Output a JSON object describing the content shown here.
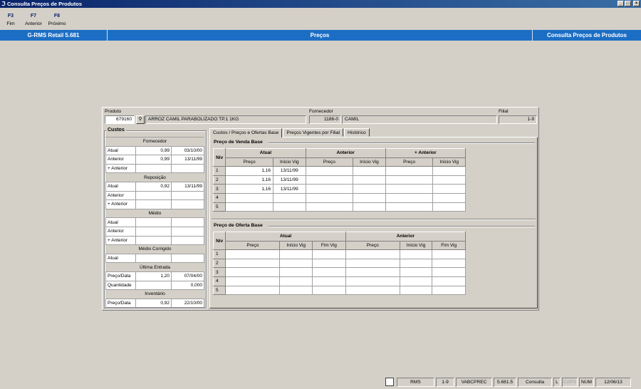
{
  "window": {
    "title": "Consulta Preços de Produtos",
    "min": "_",
    "max": "□",
    "close": "×"
  },
  "fkeys": [
    {
      "key": "F3",
      "label": "Fim"
    },
    {
      "key": "F7",
      "label": "Anterior"
    },
    {
      "key": "F8",
      "label": "Próximo"
    }
  ],
  "band": {
    "left": "G-RMS Retail 5.681",
    "center": "Preços",
    "right": "Consulta Preços de Produtos"
  },
  "produto": {
    "label": "Produto",
    "code": "679160",
    "desc": "ARROZ CAMIL PARABOLIZADO TP.1 1KG"
  },
  "fornecedor": {
    "label": "Fornecedor",
    "code": "1186-0",
    "name": "CAMIL"
  },
  "filial": {
    "label": "Filial",
    "value": "1-9"
  },
  "custos": {
    "title": "Custos",
    "fornecedor": {
      "title": "Fornecedor",
      "rows": [
        {
          "label": "Atual",
          "v1": "0,99",
          "v2": "03/10/00"
        },
        {
          "label": "Anterior",
          "v1": "0,99",
          "v2": "13/11/99"
        },
        {
          "label": "+ Anterior",
          "v1": "",
          "v2": ""
        }
      ]
    },
    "reposicao": {
      "title": "Reposição",
      "rows": [
        {
          "label": "Atual",
          "v1": "0,92",
          "v2": "13/11/99"
        },
        {
          "label": "Anterior",
          "v1": "",
          "v2": ""
        },
        {
          "label": "+ Anterior",
          "v1": "",
          "v2": ""
        }
      ]
    },
    "medio": {
      "title": "Médio",
      "rows": [
        {
          "label": "Atual",
          "v1": "",
          "v2": ""
        },
        {
          "label": "Anterior",
          "v1": "",
          "v2": ""
        },
        {
          "label": "+ Anterior",
          "v1": "",
          "v2": ""
        }
      ]
    },
    "medio_corrigido": {
      "title": "Médio Corrigido",
      "rows": [
        {
          "label": "Atual",
          "v1": "",
          "v2": ""
        }
      ]
    },
    "ultima_entrada": {
      "title": "Última Entrada",
      "rows": [
        {
          "label": "Preço/Data",
          "v1": "1,20",
          "v2": "07/04/00"
        },
        {
          "label": "Quantidade",
          "v1": "",
          "v2": "0,000"
        }
      ]
    },
    "inventario": {
      "title": "Inventário",
      "rows": [
        {
          "label": "Preço/Data",
          "v1": "0,92",
          "v2": "22/10/00"
        }
      ]
    }
  },
  "tabs": [
    {
      "label": "Custos / Preços e Ofertas Base"
    },
    {
      "label": "Preços Vigentes por Filial"
    },
    {
      "label": "Histórico"
    }
  ],
  "venda": {
    "title": "Preço de Venda Base",
    "niv": "Nív",
    "groups": [
      "Atual",
      "Anterior",
      "+ Anterior"
    ],
    "cols": [
      "Preço",
      "Início Vig",
      "Preço",
      "Início Vig",
      "Preço",
      "Início Vig"
    ],
    "rows": [
      {
        "n": "1",
        "c": [
          "1,16",
          "13/11/99",
          "",
          "",
          "",
          ""
        ]
      },
      {
        "n": "2",
        "c": [
          "1,16",
          "13/11/99",
          "",
          "",
          "",
          ""
        ]
      },
      {
        "n": "3",
        "c": [
          "1,16",
          "13/11/99",
          "",
          "",
          "",
          ""
        ]
      },
      {
        "n": "4",
        "c": [
          "",
          "",
          "",
          "",
          "",
          ""
        ]
      },
      {
        "n": "5",
        "c": [
          "",
          "",
          "",
          "",
          "",
          ""
        ]
      }
    ]
  },
  "oferta": {
    "title": "Preço de Oferta Base",
    "niv": "Nív",
    "groups": [
      "Atual",
      "Anterior"
    ],
    "cols": [
      "Preço",
      "Início Vig",
      "Fim Vig",
      "Preço",
      "Início Vig",
      "Fim Vig"
    ],
    "rows": [
      {
        "n": "1",
        "c": [
          "",
          "",
          "",
          "",
          "",
          ""
        ]
      },
      {
        "n": "2",
        "c": [
          "",
          "",
          "",
          "",
          "",
          ""
        ]
      },
      {
        "n": "3",
        "c": [
          "",
          "",
          "",
          "",
          "",
          ""
        ]
      },
      {
        "n": "4",
        "c": [
          "",
          "",
          "",
          "",
          "",
          ""
        ]
      },
      {
        "n": "5",
        "c": [
          "",
          "",
          "",
          "",
          "",
          ""
        ]
      }
    ]
  },
  "status": {
    "rms": "RMS",
    "filial": "1-9",
    "prog": "VABCPREC",
    "versao": "5.681.5",
    "modo": "Consulta",
    "l": "L",
    "caps": "CAPS",
    "num": "NUM",
    "data": "12/06/13"
  }
}
